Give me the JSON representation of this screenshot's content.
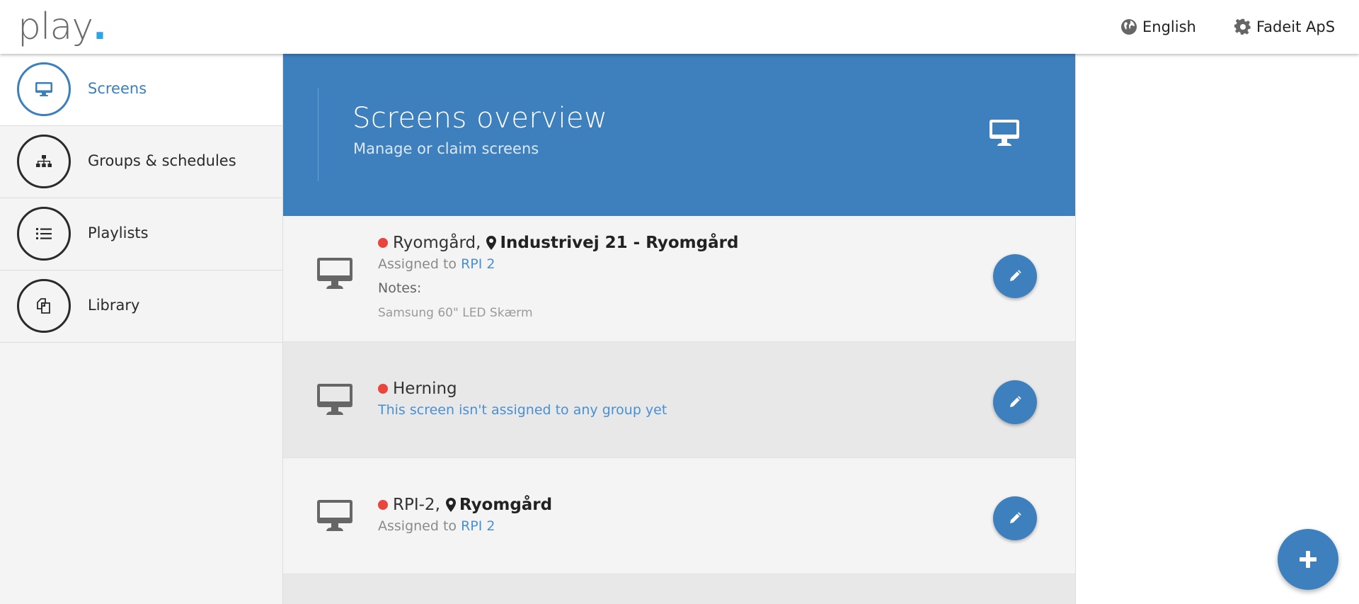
{
  "header": {
    "logo_text": "play",
    "logo_dot": ".",
    "language_label": "English",
    "language_icon": "globe-icon",
    "account_label": "Fadeit ApS",
    "account_icon": "gear-icon"
  },
  "sidebar": {
    "items": [
      {
        "label": "Screens",
        "icon": "monitor-icon",
        "active": true
      },
      {
        "label": "Groups & schedules",
        "icon": "sitemap-icon",
        "active": false
      },
      {
        "label": "Playlists",
        "icon": "list-icon",
        "active": false
      },
      {
        "label": "Library",
        "icon": "copy-icon",
        "active": false
      }
    ]
  },
  "hero": {
    "title": "Screens overview",
    "subtitle": "Manage or claim screens",
    "icon": "monitor-icon"
  },
  "screens": [
    {
      "name": "Ryomgård,",
      "location": "Industrivej 21 - Ryomgård",
      "status_color": "#e8453c",
      "assigned_prefix": "Assigned to",
      "assigned_group": "RPI 2",
      "notes_label": "Notes:",
      "notes": "Samsung 60\" LED Skærm"
    },
    {
      "name": "Herning",
      "status_color": "#e8453c",
      "unassigned_text": "This screen isn't assigned to any group yet"
    },
    {
      "name": "RPI-2,",
      "location": "Ryomgård",
      "status_color": "#e8453c",
      "assigned_prefix": "Assigned to",
      "assigned_group": "RPI 2"
    }
  ],
  "colors": {
    "accent": "#3d80bd",
    "link": "#4a90d0",
    "status_offline": "#e8453c",
    "logo_dot": "#2ea3e6"
  },
  "fab": {
    "icon": "plus-icon"
  }
}
